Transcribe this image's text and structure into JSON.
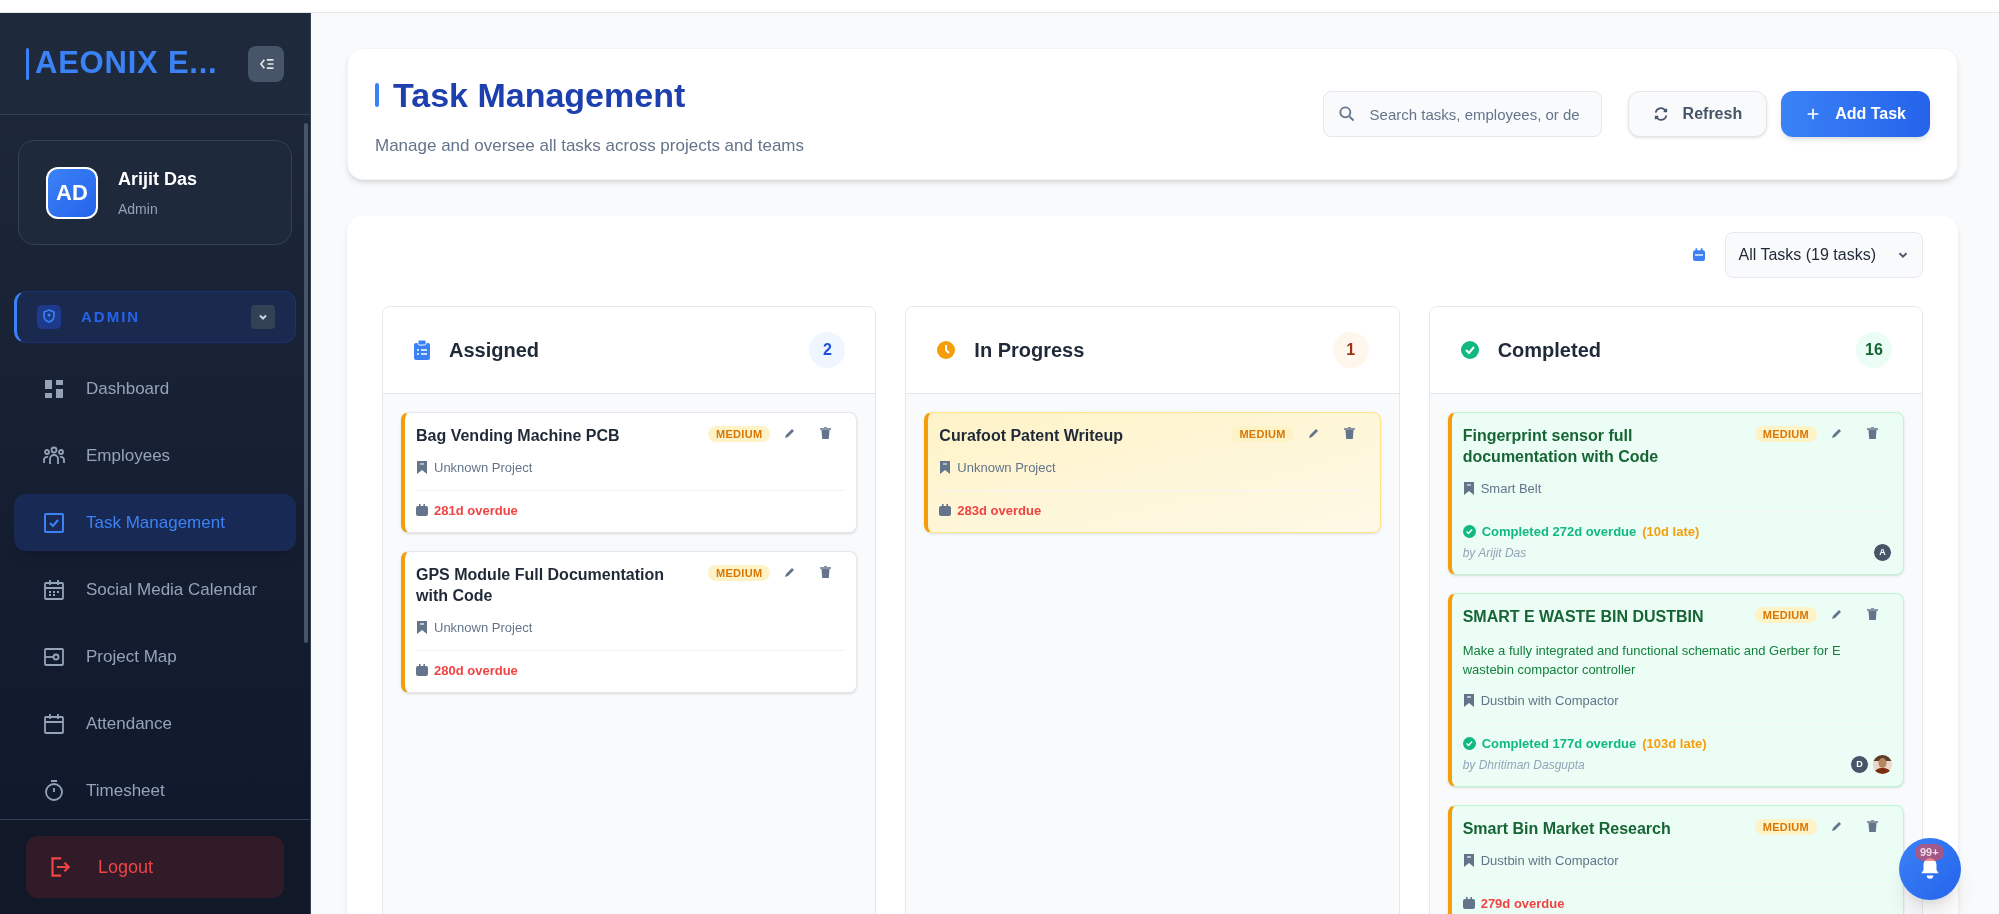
{
  "sidebar": {
    "logo": "AEONIX E...",
    "user": {
      "initials": "AD",
      "name": "Arijit Das",
      "role": "Admin"
    },
    "section": {
      "label": "ADMIN",
      "expanded": true
    },
    "items": [
      {
        "label": "Dashboard",
        "selected": false
      },
      {
        "label": "Employees",
        "selected": false
      },
      {
        "label": "Task Management",
        "selected": true
      },
      {
        "label": "Social Media Calendar",
        "selected": false
      },
      {
        "label": "Project Map",
        "selected": false
      },
      {
        "label": "Attendance",
        "selected": false
      },
      {
        "label": "Timesheet",
        "selected": false
      }
    ],
    "logout": "Logout"
  },
  "header": {
    "title": "Task Management",
    "subtitle": "Manage and oversee all tasks across projects and teams",
    "search": {
      "placeholder": "Search tasks, employees, or de"
    },
    "refresh": "Refresh",
    "add": "Add Task"
  },
  "filter": {
    "value": "All Tasks (19 tasks)"
  },
  "columns": [
    {
      "kind": "assigned",
      "title": "Assigned",
      "count": "2",
      "cards": [
        {
          "title": "Bag Vending Machine PCB",
          "priority": "MEDIUM",
          "project": "Unknown Project",
          "due": "281d overdue"
        },
        {
          "title": "GPS Module Full Documentation with Code",
          "priority": "MEDIUM",
          "project": "Unknown Project",
          "due": "280d overdue"
        }
      ]
    },
    {
      "kind": "in_progress",
      "title": "In Progress",
      "count": "1",
      "cards": [
        {
          "title": "Curafoot Patent Writeup",
          "priority": "MEDIUM",
          "project": "Unknown Project",
          "due": "283d overdue"
        }
      ]
    },
    {
      "kind": "completed",
      "title": "Completed",
      "count": "16",
      "cards": [
        {
          "title": "Fingerprint sensor full documentation with Code",
          "priority": "MEDIUM",
          "project": "Smart Belt",
          "status": "Completed 272d overdue",
          "late": "(10d late)",
          "by": "by Arijit Das",
          "avatars": [
            {
              "kind": "initial",
              "text": "A"
            }
          ]
        },
        {
          "title": "SMART E WASTE BIN DUSTBIN",
          "priority": "MEDIUM",
          "description": "Make a fully integrated and functional schematic and Gerber for E wastebin compactor controller",
          "project": "Dustbin with Compactor",
          "status": "Completed 177d overdue",
          "late": "(103d late)",
          "by": "by Dhritiman Dasgupta",
          "avatars": [
            {
              "kind": "initial",
              "text": "D"
            },
            {
              "kind": "picture"
            }
          ]
        },
        {
          "title": "Smart Bin Market Research",
          "priority": "MEDIUM",
          "project": "Dustbin with Compactor",
          "due": "279d overdue"
        }
      ]
    }
  ],
  "notifications": {
    "badge": "99+"
  }
}
